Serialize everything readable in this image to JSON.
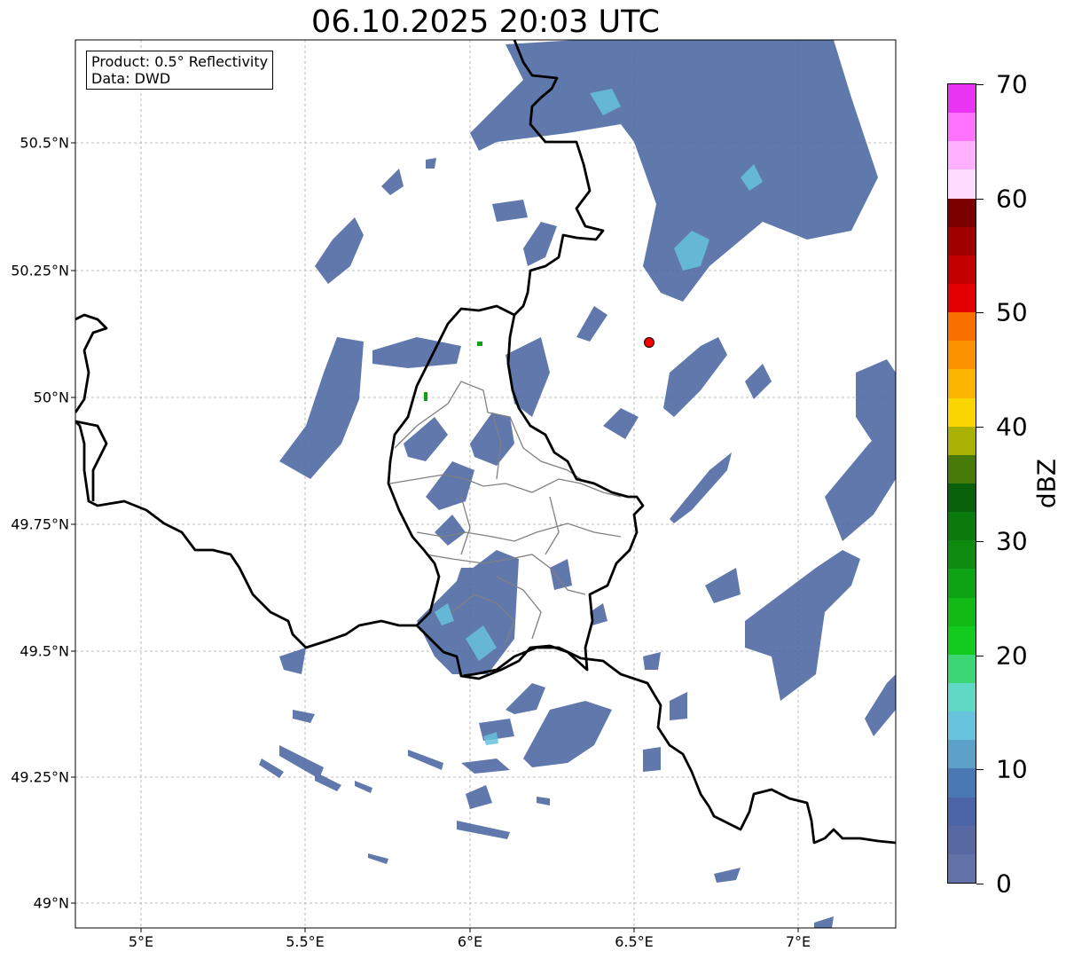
{
  "title": "06.10.2025 20:03 UTC",
  "info": {
    "product": "Product: 0.5° Reflectivity",
    "data": "Data: DWD"
  },
  "axes": {
    "lat_ticks": [
      "50.5°N",
      "50.25°N",
      "50°N",
      "49.75°N",
      "49.5°N",
      "49.25°N",
      "49°N"
    ],
    "lon_ticks": [
      "5°E",
      "5.5°E",
      "6°E",
      "6.5°E",
      "7°E"
    ]
  },
  "colorbar": {
    "unit": "dBZ",
    "tick_labels": [
      "0",
      "10",
      "20",
      "30",
      "40",
      "50",
      "60",
      "70"
    ],
    "colors": [
      "#6272a8",
      "#5868a3",
      "#4a64a6",
      "#4a78b4",
      "#5ba0c8",
      "#66c2dd",
      "#60d8c6",
      "#3dd674",
      "#12cb1c",
      "#13ba16",
      "#0ea314",
      "#0d8c10",
      "#0b7a0d",
      "#09610b",
      "#487a0a",
      "#a8b104",
      "#fbd500",
      "#fbb400",
      "#fb9300",
      "#fb7100",
      "#e40000",
      "#c20000",
      "#9f0000",
      "#7d0000",
      "#ffdcff",
      "#ffb1ff",
      "#ff73ff",
      "#e934f3"
    ]
  },
  "radar_site_marker": "red-dot",
  "colors": {
    "background": "#ffffff",
    "border": "#000000",
    "inner_border": "#808080",
    "echo_main": "#4f6aa3",
    "echo_light": "#66c2dd"
  }
}
